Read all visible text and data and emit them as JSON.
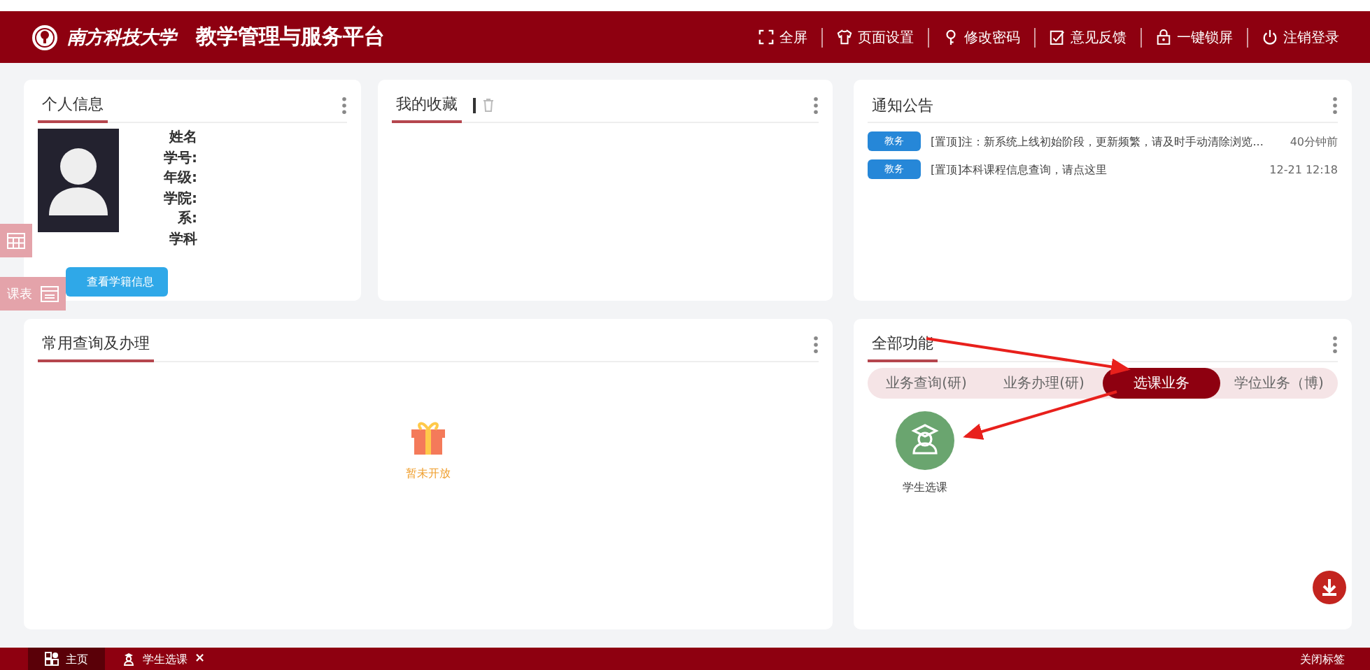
{
  "header": {
    "logo_text": "南方科技大学",
    "title": "教学管理与服务平台",
    "actions": [
      {
        "kind": "fullscreen",
        "label": "全屏"
      },
      {
        "kind": "theme",
        "label": "页面设置"
      },
      {
        "kind": "password",
        "label": "修改密码"
      },
      {
        "kind": "feedback",
        "label": "意见反馈"
      },
      {
        "kind": "lock",
        "label": "一键锁屏"
      },
      {
        "kind": "logout",
        "label": "注销登录"
      }
    ]
  },
  "profile": {
    "title": "个人信息",
    "fields": [
      "姓名",
      "学号:",
      "年级:",
      "学院:",
      "系:",
      "学科"
    ],
    "button": "查看学籍信息"
  },
  "favorites": {
    "title": "我的收藏"
  },
  "notices": {
    "title": "通知公告",
    "items": [
      {
        "tag": "教务",
        "text": "[置顶]注：新系统上线初始阶段，更新频繁，请及时手动清除浏览...",
        "time": "40分钟前"
      },
      {
        "tag": "教务",
        "text": "[置顶]本科课程信息查询，请点这里",
        "time": "12-21 12:18"
      }
    ]
  },
  "common": {
    "title": "常用查询及办理",
    "empty_text": "暂未开放"
  },
  "functions": {
    "title": "全部功能",
    "tabs": [
      {
        "label": "业务查询(研)",
        "selected": false
      },
      {
        "label": "业务办理(研)",
        "selected": false
      },
      {
        "label": "选课业务",
        "selected": true
      },
      {
        "label": "学位业务（博)",
        "selected": false
      }
    ],
    "apps": [
      {
        "label": "学生选课"
      }
    ]
  },
  "side_tabs": [
    {
      "kind": "calendar"
    },
    {
      "kind": "schedule",
      "label": "课表"
    }
  ],
  "bottom_tabs": [
    {
      "label": "主页",
      "selected": true,
      "kind": "home"
    },
    {
      "label": "学生选课",
      "selected": false,
      "kind": "app",
      "close": "×"
    }
  ],
  "close_tabs": "关闭标签"
}
